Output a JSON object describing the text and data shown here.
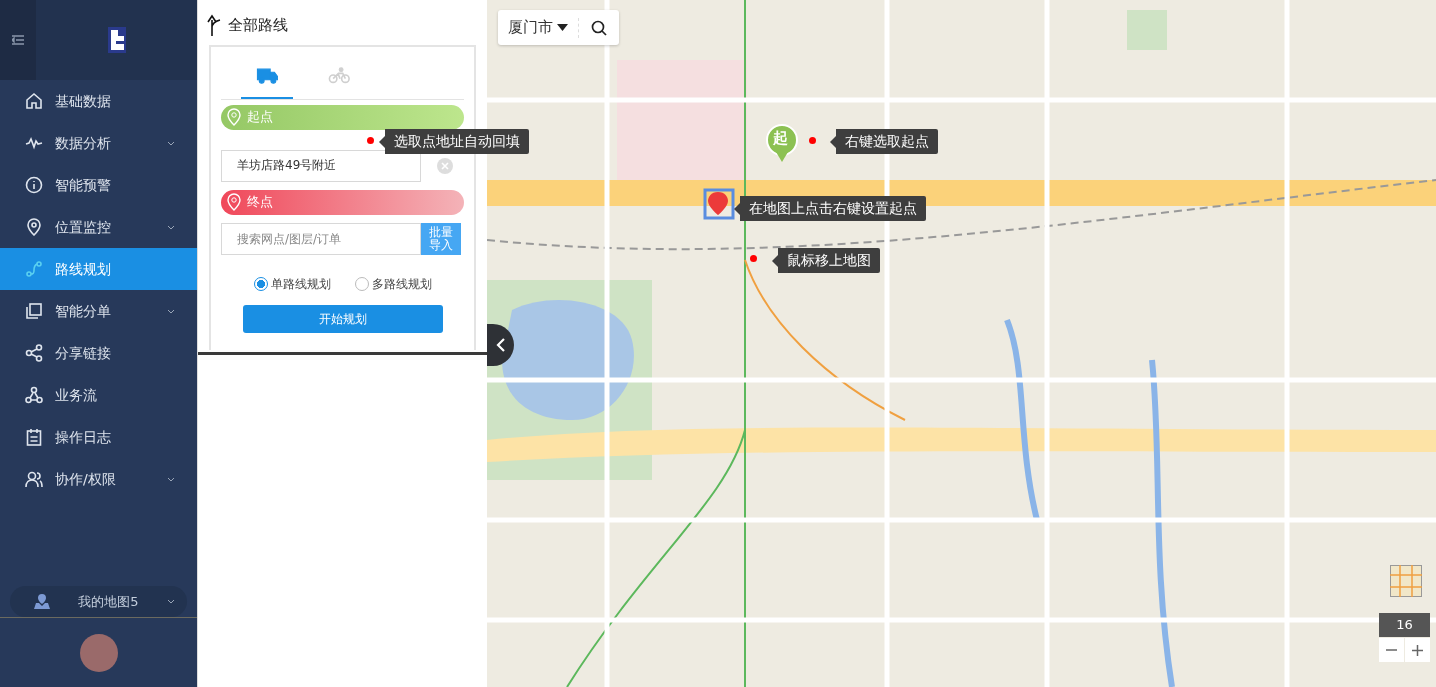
{
  "sidebar": {
    "items": [
      {
        "label": "基础数据",
        "expandable": false,
        "selected": false
      },
      {
        "label": "数据分析",
        "expandable": true,
        "selected": false
      },
      {
        "label": "智能预警",
        "expandable": false,
        "selected": false
      },
      {
        "label": "位置监控",
        "expandable": true,
        "selected": false
      },
      {
        "label": "路线规划",
        "expandable": false,
        "selected": true
      },
      {
        "label": "智能分单",
        "expandable": true,
        "selected": false
      },
      {
        "label": "分享链接",
        "expandable": false,
        "selected": false
      },
      {
        "label": "业务流",
        "expandable": false,
        "selected": false
      },
      {
        "label": "操作日志",
        "expandable": false,
        "selected": false
      },
      {
        "label": "协作/权限",
        "expandable": true,
        "selected": false
      }
    ],
    "my_map": {
      "label": "我的地图5"
    }
  },
  "panel": {
    "title": "全部路线",
    "modes": [
      {
        "kind": "truck",
        "selected": true
      },
      {
        "kind": "bicycle",
        "selected": false
      }
    ],
    "start": {
      "label": "起点",
      "value": "羊坊店路49号附近"
    },
    "end": {
      "label": "终点",
      "placeholder": "搜索网点/图层/订单",
      "import_button": "批量导入"
    },
    "plan_types": [
      {
        "label": "单路线规划",
        "selected": true
      },
      {
        "label": "多路线规划",
        "selected": false
      }
    ],
    "start_button": "开始规划"
  },
  "map": {
    "city": "厦门市",
    "start_marker": "起",
    "zoom": "16",
    "tooltips": [
      {
        "text": "选取点地址自动回填"
      },
      {
        "text": "右键选取起点"
      },
      {
        "text": "在地图上点击右键设置起点"
      },
      {
        "text": "鼠标移上地图"
      }
    ]
  }
}
